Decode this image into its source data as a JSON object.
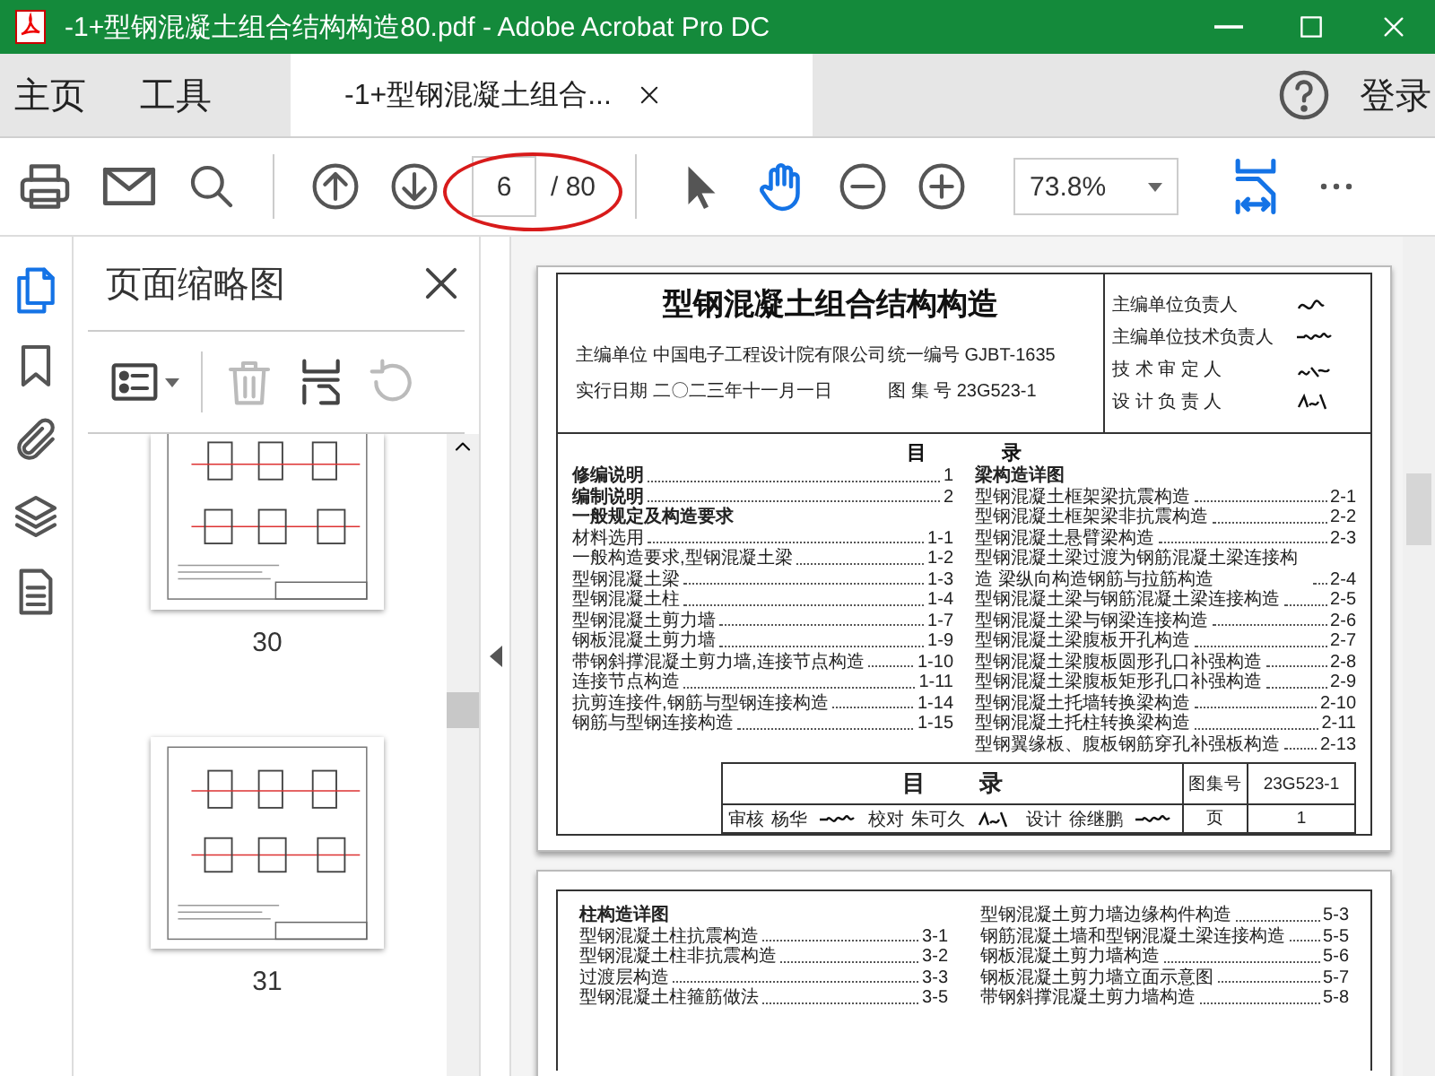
{
  "window": {
    "title": "-1+型钢混凝土组合结构构造80.pdf - Adobe Acrobat Pro DC"
  },
  "tabs": [
    {
      "label": "主页",
      "kind": "nav",
      "selected": false
    },
    {
      "label": "工具",
      "kind": "nav",
      "selected": false
    },
    {
      "label": "-1+型钢混凝土组合...",
      "kind": "document",
      "selected": true
    }
  ],
  "account": {
    "label": "登录"
  },
  "toolbar": {
    "page_current": "6",
    "page_total": "/ 80",
    "zoom": "73.8%",
    "modes": [
      {
        "kind": "select",
        "selected": false
      },
      {
        "kind": "hand",
        "selected": true
      }
    ]
  },
  "sidebar": {
    "rail": [
      {
        "kind": "pages",
        "selected": true
      },
      {
        "kind": "bookmarks",
        "selected": false
      },
      {
        "kind": "attachments",
        "selected": false
      },
      {
        "kind": "layers",
        "selected": false
      },
      {
        "kind": "document",
        "selected": false
      }
    ],
    "title": "页面缩略图",
    "tools": [
      {
        "kind": "options",
        "disabled": false
      },
      {
        "kind": "delete",
        "disabled": true
      },
      {
        "kind": "extract",
        "disabled": false
      },
      {
        "kind": "rotate",
        "disabled": true
      }
    ],
    "thumbnails": [
      {
        "label": "30"
      },
      {
        "label": "31"
      }
    ]
  },
  "page1": {
    "title": "型钢混凝土组合结构构造",
    "fields": [
      {
        "label": "主编单位",
        "value": "中国电子工程设计院有限公司"
      },
      {
        "label": "统一编号",
        "value": "GJBT-1635"
      },
      {
        "label": "实行日期",
        "value": "二〇二三年十一月一日"
      },
      {
        "label": "图 集 号",
        "value": "23G523-1"
      }
    ],
    "signoffs": [
      {
        "role": "主编单位负责人"
      },
      {
        "role": "主编单位技术负责人"
      },
      {
        "role": "技 术 审 定 人"
      },
      {
        "role": "设 计 负 责 人"
      }
    ],
    "toc_heading": [
      "目",
      "录"
    ],
    "toc_left": [
      {
        "text": "修编说明",
        "page": "1",
        "bold": true
      },
      {
        "text": "编制说明",
        "page": "2",
        "bold": true
      },
      {
        "text": "一般规定及构造要求",
        "bold": true
      },
      {
        "text": "材料选用",
        "page": "1-1",
        "bold": false
      },
      {
        "text": "一般构造要求,型钢混凝土梁",
        "page": "1-2",
        "bold": false
      },
      {
        "text": "型钢混凝土梁",
        "page": "1-3",
        "bold": false
      },
      {
        "text": "型钢混凝土柱",
        "page": "1-4",
        "bold": false
      },
      {
        "text": "型钢混凝土剪力墙",
        "page": "1-7",
        "bold": false
      },
      {
        "text": "钢板混凝土剪力墙",
        "page": "1-9",
        "bold": false
      },
      {
        "text": "带钢斜撑混凝土剪力墙,连接节点构造",
        "page": "1-10",
        "bold": false
      },
      {
        "text": "连接节点构造",
        "page": "1-11",
        "bold": false
      },
      {
        "text": "抗剪连接件,钢筋与型钢连接构造",
        "page": "1-14",
        "bold": false
      },
      {
        "text": "钢筋与型钢连接构造",
        "page": "1-15",
        "bold": false
      }
    ],
    "toc_right": [
      {
        "text": "梁构造详图",
        "bold": true
      },
      {
        "text": "型钢混凝土框架梁抗震构造",
        "page": "2-1",
        "bold": false
      },
      {
        "text": "型钢混凝土框架梁非抗震构造",
        "page": "2-2",
        "bold": false
      },
      {
        "text": "型钢混凝土悬臂梁构造",
        "page": "2-3",
        "bold": false
      },
      {
        "text": "型钢混凝土梁过渡为钢筋混凝土梁连接构造 梁纵向构造钢筋与拉筋构造",
        "page": "2-4",
        "bold": false
      },
      {
        "text": "型钢混凝土梁与钢筋混凝土梁连接构造",
        "page": "2-5",
        "bold": false
      },
      {
        "text": "型钢混凝土梁与钢梁连接构造",
        "page": "2-6",
        "bold": false
      },
      {
        "text": "型钢混凝土梁腹板开孔构造",
        "page": "2-7",
        "bold": false
      },
      {
        "text": "型钢混凝土梁腹板圆形孔口补强构造",
        "page": "2-8",
        "bold": false
      },
      {
        "text": "型钢混凝土梁腹板矩形孔口补强构造",
        "page": "2-9",
        "bold": false
      },
      {
        "text": "型钢混凝土托墙转换梁构造",
        "page": "2-10",
        "bold": false
      },
      {
        "text": "型钢混凝土托柱转换梁构造",
        "page": "2-11",
        "bold": false
      },
      {
        "text": "型钢翼缘板、腹板钢筋穿孔补强板构造",
        "page": "2-13",
        "bold": false
      }
    ],
    "footer": {
      "title": [
        "目",
        "录"
      ],
      "atlas_label": "图集号",
      "atlas_no": "23G523-1",
      "cells": [
        "审核",
        "杨华",
        "校对",
        "朱可久",
        "设计",
        "徐继鹏"
      ],
      "page_label": "页",
      "page_no": "1"
    }
  },
  "page2": {
    "toc_left": [
      {
        "text": "柱构造详图",
        "bold": true
      },
      {
        "text": "型钢混凝土柱抗震构造",
        "page": "3-1",
        "bold": false
      },
      {
        "text": "型钢混凝土柱非抗震构造",
        "page": "3-2",
        "bold": false
      },
      {
        "text": "过渡层构造",
        "page": "3-3",
        "bold": false
      },
      {
        "text": "型钢混凝土柱箍筋做法",
        "page": "3-5",
        "bold": false
      }
    ],
    "toc_right": [
      {
        "text": "型钢混凝土剪力墙边缘构件构造",
        "page": "5-3",
        "bold": false
      },
      {
        "text": "钢筋混凝土墙和型钢混凝土梁连接构造",
        "page": "5-5",
        "bold": false
      },
      {
        "text": "钢板混凝土剪力墙构造",
        "page": "5-6",
        "bold": false
      },
      {
        "text": "钢板混凝土剪力墙立面示意图",
        "page": "5-7",
        "bold": false
      },
      {
        "text": "带钢斜撑混凝土剪力墙构造",
        "page": "5-8",
        "bold": false
      }
    ]
  }
}
